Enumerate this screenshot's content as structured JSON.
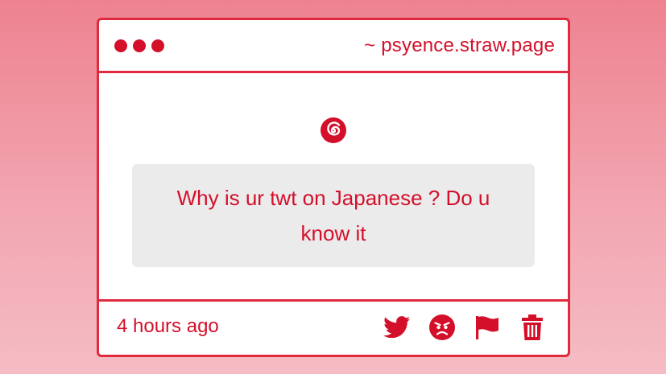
{
  "window": {
    "url": "~ psyence.straw.page"
  },
  "post": {
    "question": "Why is ur twt on Japanese ? Do u know it",
    "time": "4 hours ago"
  },
  "icons": {
    "header": "spiral-icon",
    "actions": [
      "twitter-icon",
      "angry-face-icon",
      "flag-icon",
      "trash-icon"
    ]
  },
  "colors": {
    "accent": "#d40f2a",
    "border": "#e02a3d",
    "question_bg": "#ecebec",
    "bg_top": "#ee8290",
    "bg_bottom": "#f5bcc4"
  }
}
